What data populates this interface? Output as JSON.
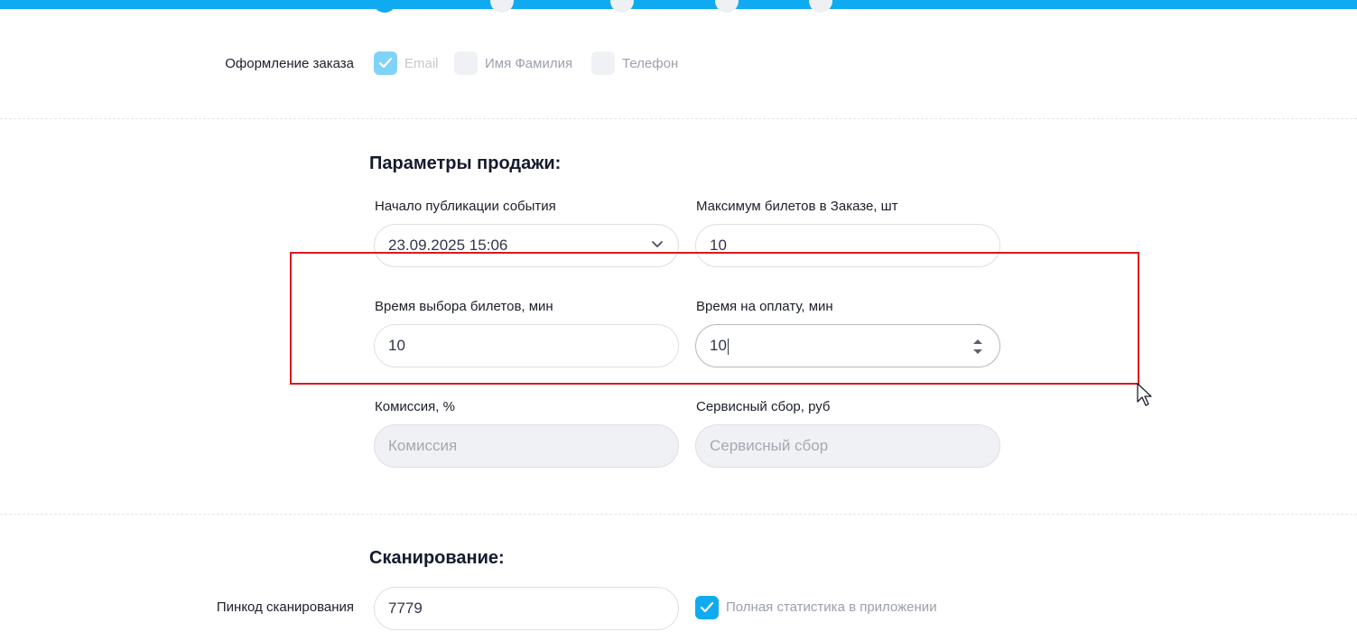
{
  "order_form": {
    "label": "Оформление заказа",
    "options": [
      {
        "label": "Email",
        "checked": true
      },
      {
        "label": "Имя Фамилия",
        "checked": false
      },
      {
        "label": "Телефон",
        "checked": false
      }
    ]
  },
  "sale_params": {
    "title": "Параметры продажи:",
    "publication_start": {
      "label": "Начало публикации события",
      "value": "23.09.2025 15:06"
    },
    "max_tickets": {
      "label": "Максимум билетов в Заказе, шт",
      "value": "10"
    },
    "selection_time": {
      "label": "Время выбора билетов, мин",
      "value": "10"
    },
    "payment_time": {
      "label": "Время на оплату, мин",
      "value": "10"
    },
    "commission": {
      "label": "Комиссия, %",
      "placeholder": "Комиссия"
    },
    "service_fee": {
      "label": "Сервисный сбор, руб",
      "placeholder": "Сервисный сбор"
    }
  },
  "scanning": {
    "title": "Сканирование:",
    "pincode": {
      "label": "Пинкод сканирования",
      "value": "7779"
    },
    "full_stats": {
      "label": "Полная статистика в приложении",
      "checked": true
    }
  },
  "colors": {
    "accent": "#10aaf0",
    "highlight": "#d9191f"
  }
}
